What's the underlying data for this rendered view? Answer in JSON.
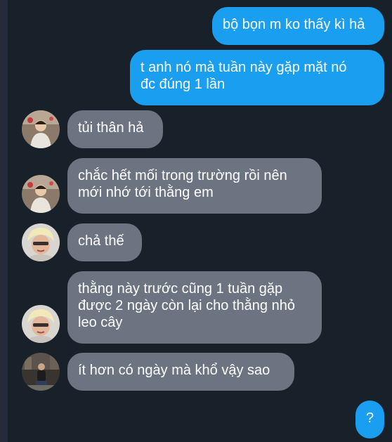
{
  "messages": [
    {
      "side": "out",
      "text": "bộ bọn m ko thấy kì hả"
    },
    {
      "side": "out",
      "text": "t anh nó mà tuần này gặp mặt nó\nđc đúng 1 lần"
    },
    {
      "side": "in",
      "avatar": "boy-avatar",
      "text": "tủi thân hả"
    },
    {
      "side": "in",
      "avatar": "boy-avatar",
      "text": "chắc hết mối trong trường rồi nên\nmới nhớ tới thằng em"
    },
    {
      "side": "in",
      "avatar": "blonde-avatar",
      "text": "chả thế"
    },
    {
      "side": "in",
      "avatar": "blonde-avatar",
      "text": "thằng này trước cũng 1 tuần gặp\nđược 2 ngày còn lại cho thằng nhỏ\nleo cây"
    },
    {
      "side": "in",
      "avatar": "street-avatar",
      "text": "ít hơn có ngày mà khổ vậy sao"
    },
    {
      "side": "out",
      "text": "?"
    }
  ],
  "colors": {
    "background": "#18202a",
    "outgoing_bubble": "#1a9ff0",
    "incoming_bubble": "#6b7480",
    "text": "#ffffff"
  }
}
